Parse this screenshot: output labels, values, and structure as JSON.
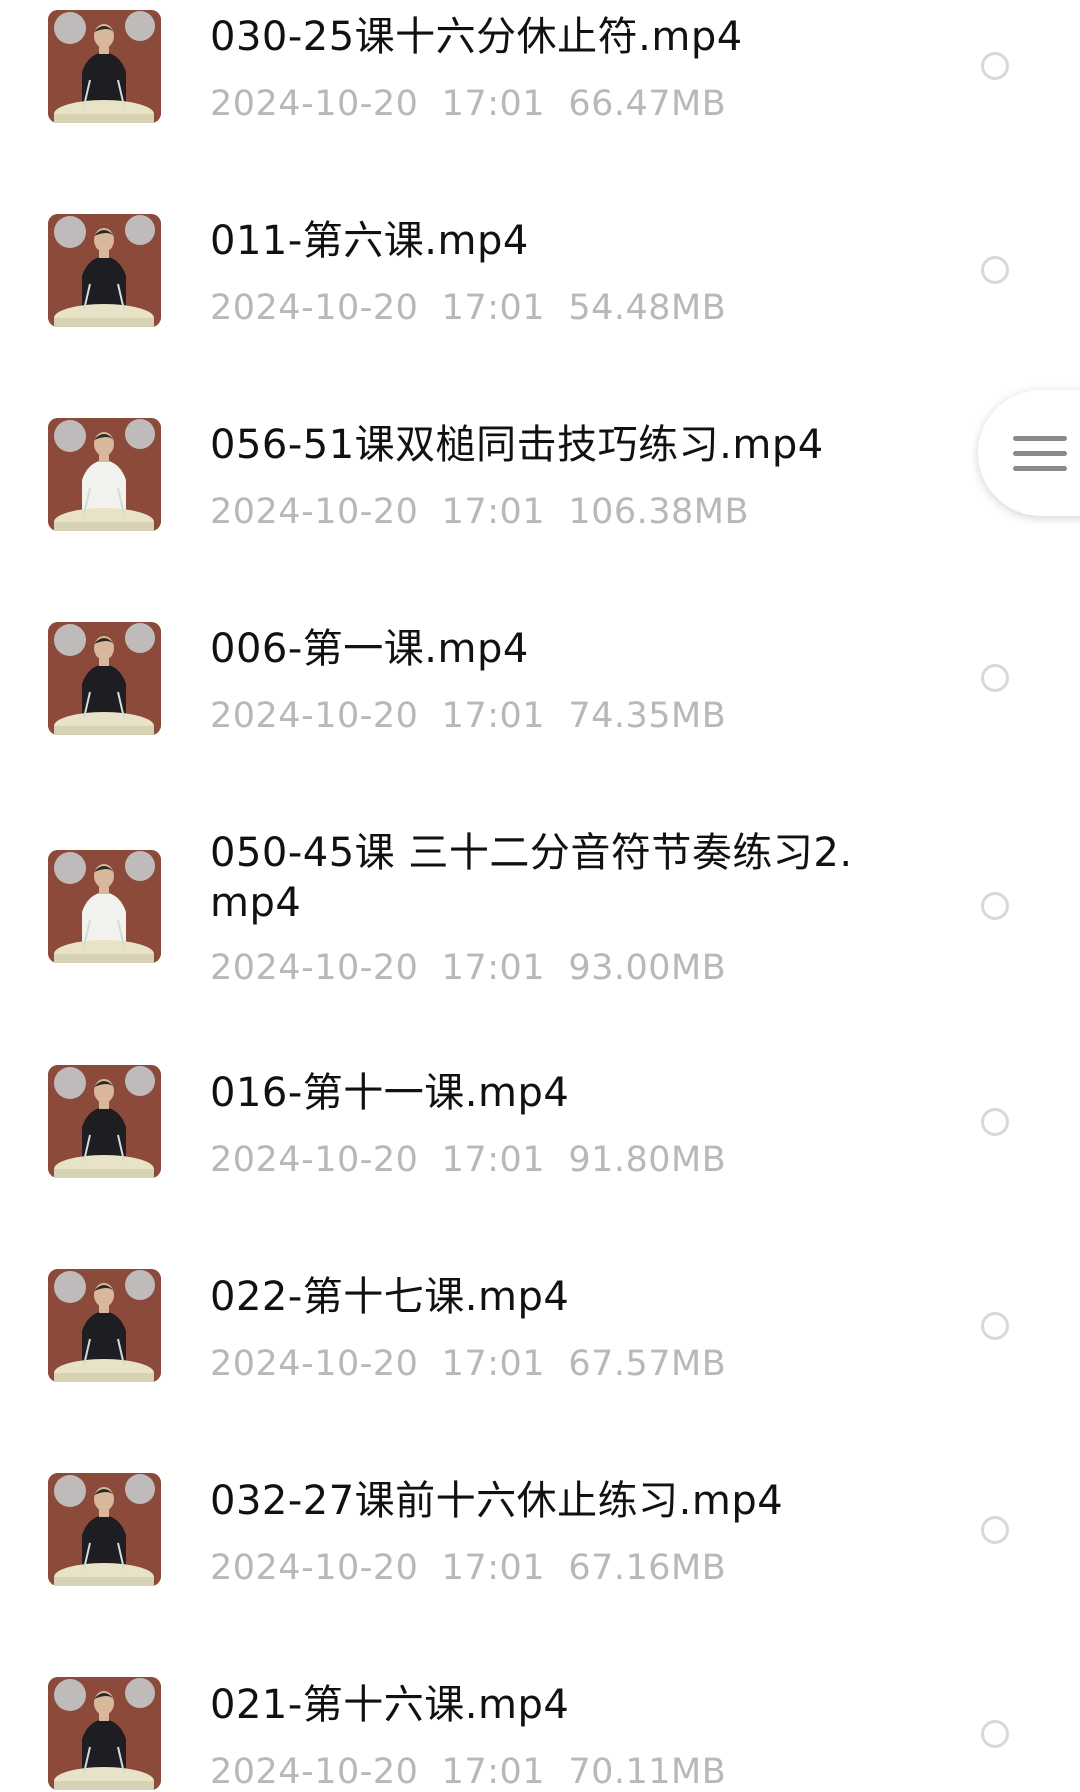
{
  "files": [
    {
      "name": "030-25课十六分休止符.mp4",
      "date": "2024-10-20",
      "time": "17:01",
      "size": "66.47MB",
      "shirt": "#1e1e22"
    },
    {
      "name": "011-第六课.mp4",
      "date": "2024-10-20",
      "time": "17:01",
      "size": "54.48MB",
      "shirt": "#1e1e22"
    },
    {
      "name": "056-51课双槌同击技巧练习.mp4",
      "date": "2024-10-20",
      "time": "17:01",
      "size": "106.38MB",
      "shirt": "#f2f2ee"
    },
    {
      "name": "006-第一课.mp4",
      "date": "2024-10-20",
      "time": "17:01",
      "size": "74.35MB",
      "shirt": "#1e1e22"
    },
    {
      "name": "050-45课 三十二分音符节奏练习2.mp4",
      "date": "2024-10-20",
      "time": "17:01",
      "size": "93.00MB",
      "shirt": "#f2f2ee"
    },
    {
      "name": "016-第十一课.mp4",
      "date": "2024-10-20",
      "time": "17:01",
      "size": "91.80MB",
      "shirt": "#1e1e22"
    },
    {
      "name": "022-第十七课.mp4",
      "date": "2024-10-20",
      "time": "17:01",
      "size": "67.57MB",
      "shirt": "#1e1e22"
    },
    {
      "name": "032-27课前十六休止练习.mp4",
      "date": "2024-10-20",
      "time": "17:01",
      "size": "67.16MB",
      "shirt": "#1e1e22"
    },
    {
      "name": "021-第十六课.mp4",
      "date": "2024-10-20",
      "time": "17:01",
      "size": "70.11MB",
      "shirt": "#1e1e22"
    }
  ],
  "floating_menu": {
    "icon": "hamburger-menu-icon"
  },
  "colors": {
    "name_text": "#111111",
    "meta_text": "#b8b8b8",
    "radio_border": "#d8d8d8",
    "thumbnail_wall": "#8c4a3a",
    "drum_head": "#e8e2c6"
  }
}
